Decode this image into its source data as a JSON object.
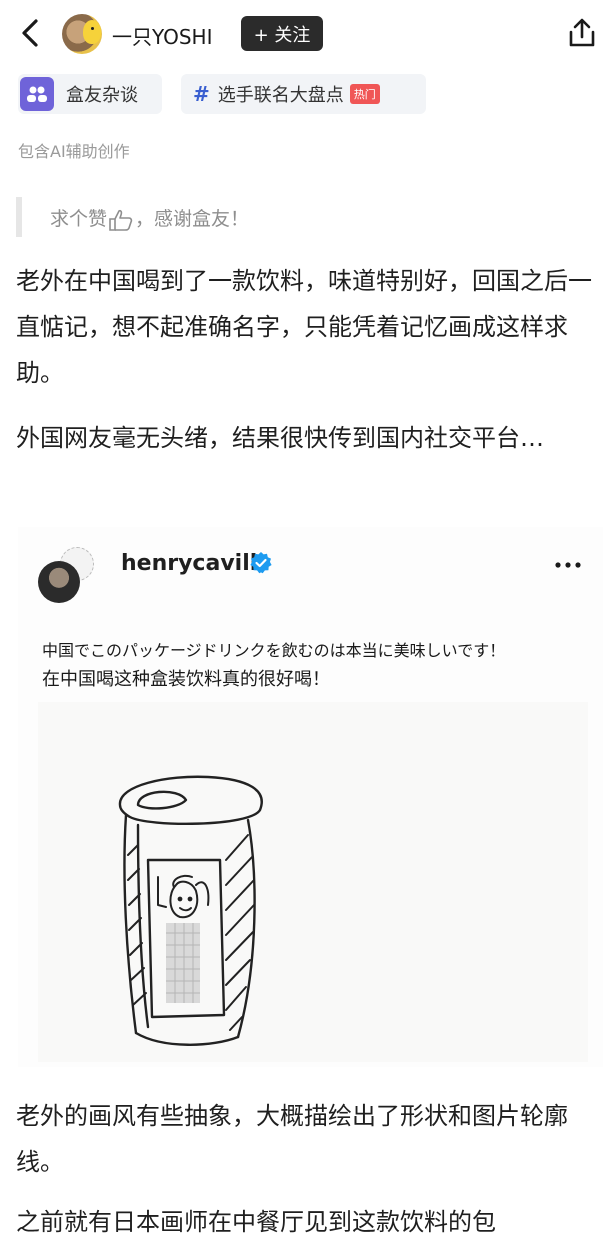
{
  "header": {
    "back_icon": "chevron-left-icon",
    "username": "一只YOSHI",
    "follow_label": "+ 关注",
    "share_icon": "share-icon"
  },
  "tags": [
    {
      "icon": "group-icon",
      "label": "盒友杂谈"
    },
    {
      "icon": "hash-icon",
      "label": "选手联名大盘点",
      "badge": "热门"
    }
  ],
  "ai_note": "包含AI辅助创作",
  "quote": {
    "prefix": "求个赞",
    "suffix": "，感谢盒友！",
    "icon": "thumbs-up-icon"
  },
  "paragraphs": [
    "老外在中国喝到了一款饮料，味道特别好，回国之后一直惦记，想不起准确名字，只能凭着记忆画成这样求助。",
    "外国网友毫无头绪，结果很快传到国内社交平台…",
    "老外的画风有些抽象，大概描绘出了形状和图片轮廓线。",
    "之前就有日本画师在中餐厅见到这款饮料的包"
  ],
  "embed": {
    "username": "henrycavill",
    "verified": true,
    "more_icon": "more-horizontal-icon",
    "caption_ja": "中国でこのパッケージドリンクを飲むのは本当に美味しいです！",
    "caption_zh": "在中国喝这种盒装饮料真的很好喝！"
  },
  "colors": {
    "follow_bg": "#2b2b2b",
    "tag_bg": "#f2f4f7",
    "group_icon_bg": "#6f63d9",
    "hash": "#3a5fd0",
    "hot_badge": "#f05656",
    "verified": "#1d9bf0"
  }
}
